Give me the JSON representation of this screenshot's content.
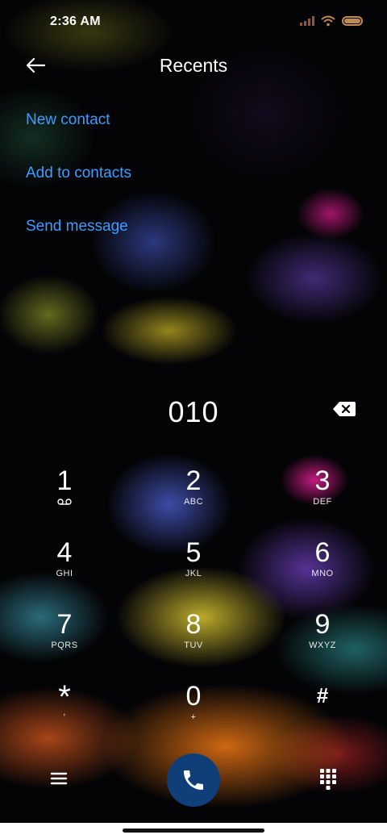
{
  "status_bar": {
    "time": "2:36 AM"
  },
  "header": {
    "title": "Recents"
  },
  "actions": [
    {
      "label": "New contact"
    },
    {
      "label": "Add to contacts"
    },
    {
      "label": "Send message"
    }
  ],
  "dialer": {
    "number": "010",
    "keys": [
      {
        "digit": "1",
        "letters": "",
        "icon": "voicemail-icon"
      },
      {
        "digit": "2",
        "letters": "ABC"
      },
      {
        "digit": "3",
        "letters": "DEF"
      },
      {
        "digit": "4",
        "letters": "GHI"
      },
      {
        "digit": "5",
        "letters": "JKL"
      },
      {
        "digit": "6",
        "letters": "MNO"
      },
      {
        "digit": "7",
        "letters": "PQRS"
      },
      {
        "digit": "8",
        "letters": "TUV"
      },
      {
        "digit": "9",
        "letters": "WXYZ"
      },
      {
        "digit": "*",
        "letters": ","
      },
      {
        "digit": "0",
        "letters": "+"
      },
      {
        "digit": "#",
        "letters": ""
      }
    ]
  },
  "bottom_bar": {
    "menu_icon": "menu-icon",
    "call_icon": "phone-icon",
    "keypad_icon": "dialpad-icon"
  },
  "colors": {
    "link": "#3d9cff",
    "call_button": "#0f3e78",
    "text": "#ffffff"
  }
}
